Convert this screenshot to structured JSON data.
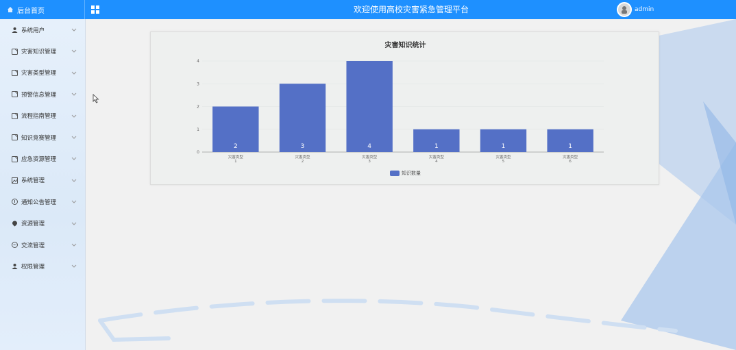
{
  "header": {
    "home_label": "后台首页",
    "site_title": "欢迎使用高校灾害紧急管理平台",
    "username": "admin"
  },
  "sidebar": {
    "items": [
      {
        "label": "系统用户",
        "icon": "user-icon"
      },
      {
        "label": "灾害知识管理",
        "icon": "document-icon"
      },
      {
        "label": "灾害类型管理",
        "icon": "document-icon"
      },
      {
        "label": "预警信息管理",
        "icon": "document-icon"
      },
      {
        "label": "流程指南管理",
        "icon": "document-icon"
      },
      {
        "label": "知识竞赛管理",
        "icon": "document-icon"
      },
      {
        "label": "应急资源管理",
        "icon": "document-icon"
      },
      {
        "label": "系统管理",
        "icon": "image-icon"
      },
      {
        "label": "通知公告管理",
        "icon": "info-icon"
      },
      {
        "label": "资源管理",
        "icon": "location-icon"
      },
      {
        "label": "交流管理",
        "icon": "chat-icon"
      },
      {
        "label": "权限管理",
        "icon": "user-icon"
      }
    ]
  },
  "colors": {
    "header_blue": "#1e90ff",
    "bar_blue": "#5470c6",
    "deco_blue": "#a9c7ec"
  },
  "chart_data": {
    "type": "bar",
    "title": "灾害知识统计",
    "categories": [
      [
        "灾害类型",
        "1"
      ],
      [
        "灾害类型",
        "2"
      ],
      [
        "灾害类型",
        "3"
      ],
      [
        "灾害类型",
        "4"
      ],
      [
        "灾害类型",
        "5"
      ],
      [
        "灾害类型",
        "6"
      ]
    ],
    "series": [
      {
        "name": "知识数量",
        "values": [
          2,
          3,
          4,
          1,
          1,
          1
        ]
      }
    ],
    "ylim": [
      0,
      4
    ],
    "yticks": [
      "0",
      "1",
      "2",
      "3",
      "4"
    ],
    "grid": true,
    "legend_position": "bottom-center"
  }
}
